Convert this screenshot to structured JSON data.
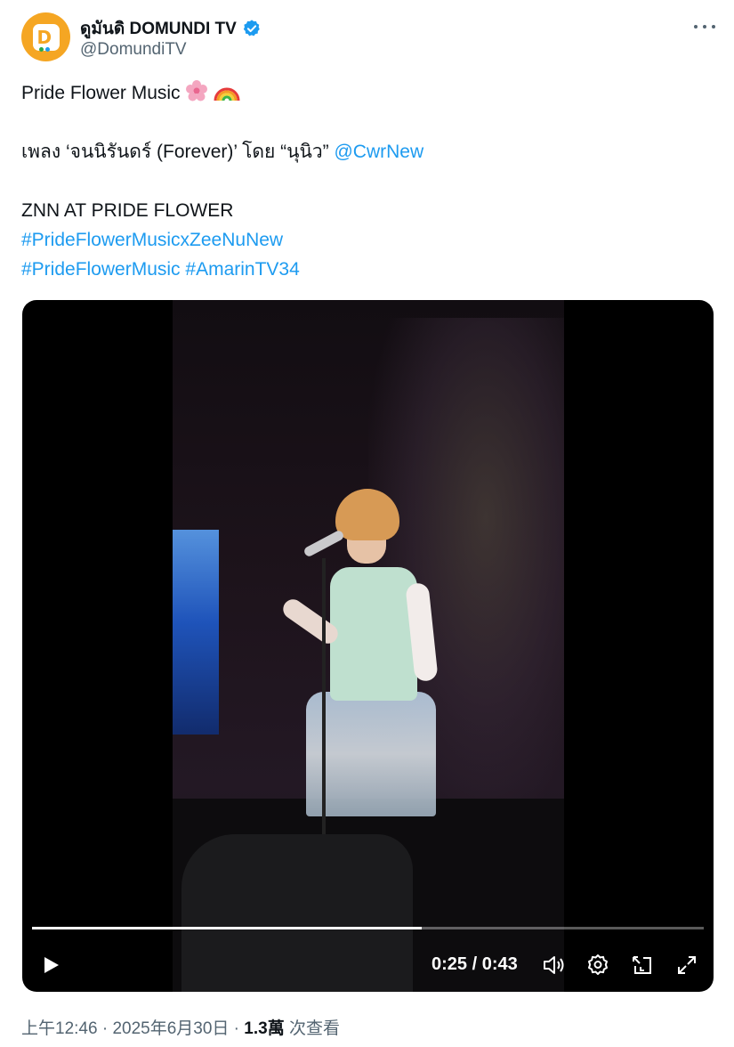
{
  "author": {
    "display_name": "ดูมันดิ DOMUNDI TV",
    "handle": "@DomundiTV",
    "avatar_letter": "D"
  },
  "tweet": {
    "line1": "Pride Flower Music",
    "line2_prefix": "เพลง ‘จนนิรันดร์ (Forever)’ โดย “นุนิว” ",
    "mention": "@CwrNew",
    "line3": "ZNN AT PRIDE FLOWER",
    "hashtag1": "#PrideFlowerMusicxZeeNuNew",
    "hashtag2": "#PrideFlowerMusic",
    "hashtag3": "#AmarinTV34"
  },
  "video": {
    "time_current": "0:25",
    "time_total": "0:43",
    "time_display": "0:25 / 0:43",
    "progress_fraction": 0.58
  },
  "meta": {
    "time": "上午12:46",
    "date": "2025年6月30日",
    "views_count": "1.3萬",
    "views_label": "次查看"
  },
  "colors": {
    "link": "#1d9bf0",
    "avatar_bg": "#f5a623",
    "secondary_text": "#536471"
  },
  "icons": [
    "verified-badge-icon",
    "more-icon",
    "cherry-blossom-emoji",
    "rainbow-emoji",
    "play-icon",
    "volume-icon",
    "settings-icon",
    "picture-in-picture-icon",
    "fullscreen-icon"
  ]
}
